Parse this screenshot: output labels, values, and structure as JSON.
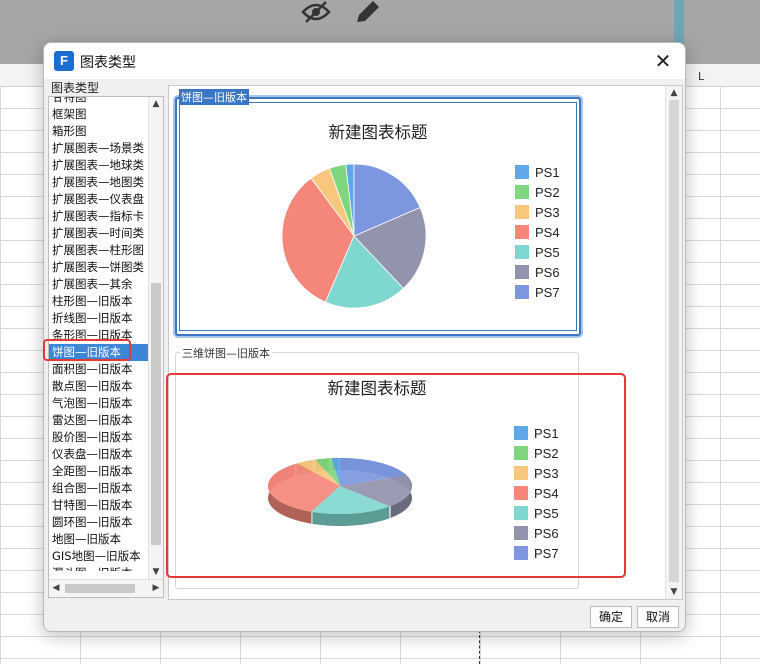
{
  "background": {
    "column_label": "L",
    "toolbar_icons": [
      "eye-slash-icon",
      "pencil-icon"
    ]
  },
  "dialog": {
    "title": "图表类型",
    "close_symbol": "✕",
    "chart_types_label": "图表类型",
    "list_items": [
      "甘特图",
      "框架图",
      "箱形图",
      "扩展图表—场景类",
      "扩展图表—地球类",
      "扩展图表—地图类",
      "扩展图表—仪表盘",
      "扩展图表—指标卡",
      "扩展图表—时间类",
      "扩展图表—柱形图",
      "扩展图表—饼图类",
      "扩展图表—其余",
      "柱形图—旧版本",
      "折线图—旧版本",
      "条形图—旧版本",
      "饼图—旧版本",
      "面积图—旧版本",
      "散点图—旧版本",
      "气泡图—旧版本",
      "雷达图—旧版本",
      "股价图—旧版本",
      "仪表盘—旧版本",
      "全距图—旧版本",
      "组合图—旧版本",
      "甘特图—旧版本",
      "圆环图—旧版本",
      "地图—旧版本",
      "GIS地图—旧版本",
      "漏斗图—旧版本"
    ],
    "selected_index": 15,
    "ok_label": "确定",
    "cancel_label": "取消"
  },
  "preview": {
    "cards": [
      {
        "label": "饼图—旧版本",
        "title": "新建图表标题"
      },
      {
        "label": "三维饼图—旧版本",
        "title": "新建图表标题"
      }
    ]
  },
  "chart_data": [
    {
      "type": "pie",
      "title": "新建图表标题",
      "categories": [
        "PS1",
        "PS2",
        "PS3",
        "PS4",
        "PS5",
        "PS6",
        "PS7"
      ],
      "values": [
        2,
        4,
        5,
        36,
        20,
        21,
        20
      ],
      "colors": [
        "#5fa8e8",
        "#7ed67e",
        "#f7c77e",
        "#f4877a",
        "#7fd8cf",
        "#9294ad",
        "#7c97e0"
      ],
      "legend": "right"
    },
    {
      "type": "pie",
      "subtype": "3d",
      "title": "新建图表标题",
      "categories": [
        "PS1",
        "PS2",
        "PS3",
        "PS4",
        "PS5",
        "PS6",
        "PS7"
      ],
      "values": [
        2,
        4,
        5,
        36,
        20,
        21,
        20
      ],
      "colors": [
        "#5fa8e8",
        "#7ed67e",
        "#f7c77e",
        "#f4877a",
        "#7fd8cf",
        "#9294ad",
        "#7c97e0"
      ],
      "legend": "right"
    }
  ]
}
